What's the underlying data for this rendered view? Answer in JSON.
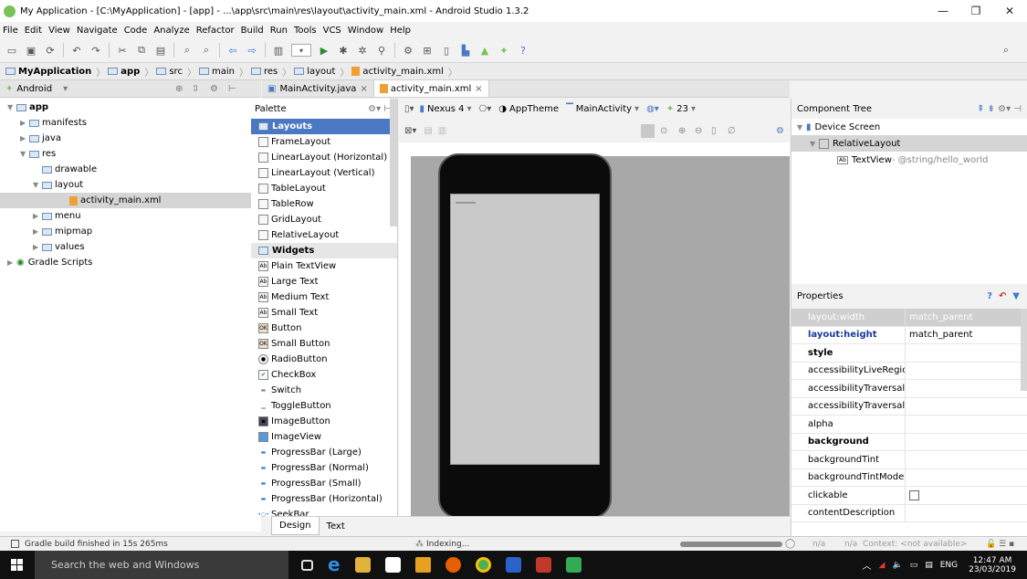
{
  "window": {
    "title": "My Application - [C:\\MyApplication] - [app] - ...\\app\\src\\main\\res\\layout\\activity_main.xml - Android Studio 1.3.2"
  },
  "menu": [
    "File",
    "Edit",
    "View",
    "Navigate",
    "Code",
    "Analyze",
    "Refactor",
    "Build",
    "Run",
    "Tools",
    "VCS",
    "Window",
    "Help"
  ],
  "breadcrumb": [
    "MyApplication",
    "app",
    "src",
    "main",
    "res",
    "layout",
    "activity_main.xml"
  ],
  "project_panel": {
    "view_selector": "Android",
    "tree": [
      {
        "label": "app",
        "depth": 0,
        "bold": true
      },
      {
        "label": "manifests",
        "depth": 1
      },
      {
        "label": "java",
        "depth": 1
      },
      {
        "label": "res",
        "depth": 1
      },
      {
        "label": "drawable",
        "depth": 2
      },
      {
        "label": "layout",
        "depth": 2
      },
      {
        "label": "activity_main.xml",
        "depth": 3,
        "selected": true
      },
      {
        "label": "menu",
        "depth": 2
      },
      {
        "label": "mipmap",
        "depth": 2
      },
      {
        "label": "values",
        "depth": 2
      },
      {
        "label": "Gradle Scripts",
        "depth": 0
      }
    ]
  },
  "editor_tabs": [
    {
      "label": "MainActivity.java",
      "active": false
    },
    {
      "label": "activity_main.xml",
      "active": true
    }
  ],
  "palette": {
    "title": "Palette",
    "groups": [
      {
        "name": "Layouts",
        "selected": true,
        "items": [
          "FrameLayout",
          "LinearLayout (Horizontal)",
          "LinearLayout (Vertical)",
          "TableLayout",
          "TableRow",
          "GridLayout",
          "RelativeLayout"
        ]
      },
      {
        "name": "Widgets",
        "selected": false,
        "items": [
          "Plain TextView",
          "Large Text",
          "Medium Text",
          "Small Text",
          "Button",
          "Small Button",
          "RadioButton",
          "CheckBox",
          "Switch",
          "ToggleButton",
          "ImageButton",
          "ImageView",
          "ProgressBar (Large)",
          "ProgressBar (Normal)",
          "ProgressBar (Small)",
          "ProgressBar (Horizontal)",
          "SeekBar"
        ]
      }
    ]
  },
  "design_toolbar": {
    "device": "Nexus 4",
    "theme": "AppTheme",
    "activity": "MainActivity",
    "api": "23"
  },
  "design_tabs": [
    {
      "label": "Design",
      "active": true
    },
    {
      "label": "Text",
      "active": false
    }
  ],
  "component_tree": {
    "title": "Component Tree",
    "items": [
      {
        "label": "Device Screen",
        "depth": 0
      },
      {
        "label": "RelativeLayout",
        "depth": 1,
        "selected": true
      },
      {
        "label": "TextView",
        "depth": 2,
        "detail": " - @string/hello_world"
      }
    ]
  },
  "properties": {
    "title": "Properties",
    "rows": [
      {
        "key": "layout:width",
        "value": "match_parent",
        "bold": true,
        "selected": true
      },
      {
        "key": "layout:height",
        "value": "match_parent",
        "bold": true
      },
      {
        "key": "style",
        "value": "",
        "bold": true
      },
      {
        "key": "accessibilityLiveRegion",
        "value": ""
      },
      {
        "key": "accessibilityTraversalAfte",
        "value": ""
      },
      {
        "key": "accessibilityTraversalBefc",
        "value": ""
      },
      {
        "key": "alpha",
        "value": ""
      },
      {
        "key": "background",
        "value": "",
        "bold": true
      },
      {
        "key": "backgroundTint",
        "value": ""
      },
      {
        "key": "backgroundTintMode",
        "value": ""
      },
      {
        "key": "clickable",
        "value": "",
        "checkbox": true
      },
      {
        "key": "contentDescription",
        "value": ""
      }
    ]
  },
  "status_bar": {
    "message": "Gradle build finished in 15s 265ms",
    "task": "Indexing...",
    "position": "n/a",
    "position2": "n/a",
    "context": "Context: <not available>"
  },
  "taskbar": {
    "search_placeholder": "Search the web and Windows",
    "language": "ENG",
    "time": "12:47 AM",
    "date": "23/03/2019"
  },
  "colors": {
    "selection": "#4a78c2",
    "tree_selection": "#d5d5d5",
    "android_green": "#78c257"
  }
}
